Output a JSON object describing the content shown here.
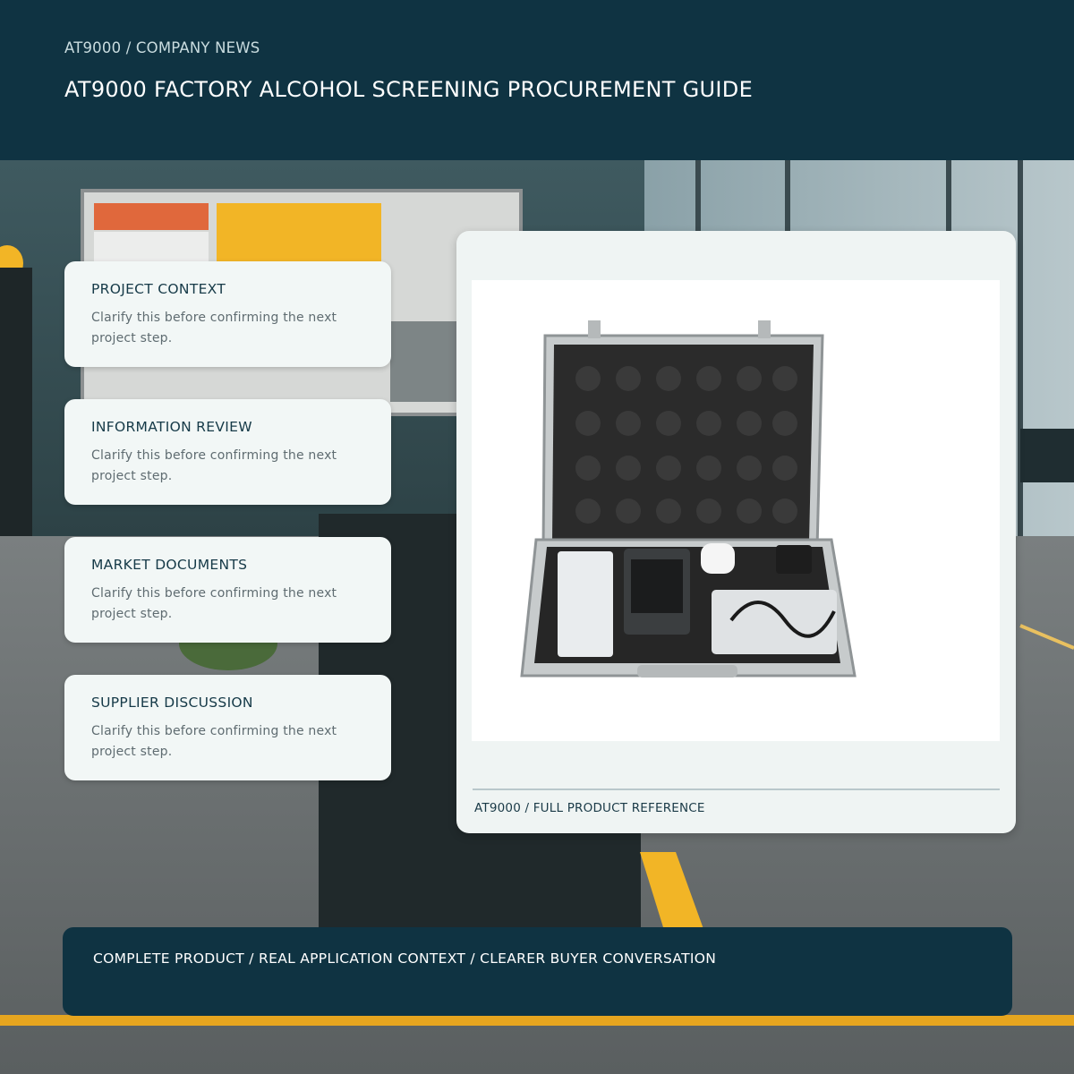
{
  "header": {
    "breadcrumb": "AT9000 / COMPANY NEWS",
    "title": "AT9000 FACTORY ALCOHOL SCREENING PROCUREMENT GUIDE"
  },
  "cards": [
    {
      "title": "PROJECT CONTEXT",
      "text": "Clarify this before confirming the next project step."
    },
    {
      "title": "INFORMATION REVIEW",
      "text": "Clarify this before confirming the next project step."
    },
    {
      "title": "MARKET DOCUMENTS",
      "text": "Clarify this before confirming the next project step."
    },
    {
      "title": "SUPPLIER DISCUSSION",
      "text": "Clarify this before confirming the next project step."
    }
  ],
  "product": {
    "caption": "AT9000 / FULL PRODUCT REFERENCE"
  },
  "banner": {
    "text": "COMPLETE PRODUCT / REAL APPLICATION CONTEXT / CLEARER BUYER CONVERSATION"
  },
  "colors": {
    "header_bg": "#0f3342",
    "card_bg": "#f2f7f6",
    "accent_yellow": "#f2b526",
    "accent_orange": "#e0683c"
  }
}
